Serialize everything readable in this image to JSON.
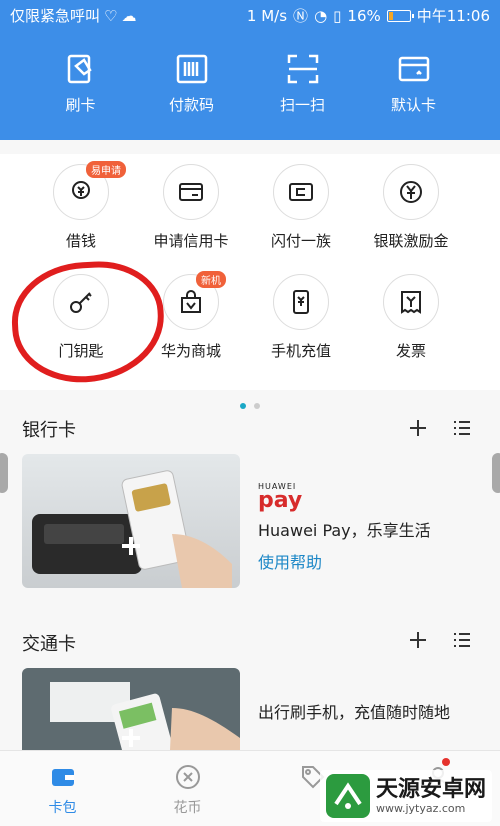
{
  "status_bar": {
    "carrier": "仅限紧急呼叫",
    "speed": "1 M/s",
    "battery": "16%",
    "time": "中午11:06"
  },
  "quick_actions": [
    {
      "label": "刷卡",
      "icon": "card-swipe-icon"
    },
    {
      "label": "付款码",
      "icon": "barcode-icon"
    },
    {
      "label": "扫一扫",
      "icon": "scan-icon"
    },
    {
      "label": "默认卡",
      "icon": "default-card-icon"
    }
  ],
  "services": [
    {
      "label": "借钱",
      "icon": "borrow-money-icon",
      "badge": "易申请"
    },
    {
      "label": "申请信用卡",
      "icon": "credit-card-icon",
      "badge": ""
    },
    {
      "label": "闪付一族",
      "icon": "quickpass-icon",
      "badge": ""
    },
    {
      "label": "银联激励金",
      "icon": "yen-coin-icon",
      "badge": ""
    },
    {
      "label": "门钥匙",
      "icon": "key-icon",
      "badge": ""
    },
    {
      "label": "华为商城",
      "icon": "shopping-bag-icon",
      "badge": "新机"
    },
    {
      "label": "手机充值",
      "icon": "phone-recharge-icon",
      "badge": ""
    },
    {
      "label": "发票",
      "icon": "invoice-icon",
      "badge": ""
    }
  ],
  "bank_section": {
    "title": "银行卡",
    "brand_small": "HUAWEI",
    "brand_logo": "pay",
    "card_title": "Huawei Pay，乐享生活",
    "card_link": "使用帮助"
  },
  "transit_section": {
    "title": "交通卡",
    "card_title": "出行刷手机，充值随时随地"
  },
  "tabs": [
    {
      "label": "卡包",
      "active": true
    },
    {
      "label": "花币",
      "active": false
    },
    {
      "label": "",
      "active": false
    },
    {
      "label": "",
      "active": false
    }
  ],
  "watermark": {
    "text": "天源安卓网",
    "url": "www.jytyaz.com"
  },
  "colors": {
    "header_blue": "#3d8ee8",
    "accent_link": "#1e88c7",
    "annotation_red": "#e01e1e"
  }
}
